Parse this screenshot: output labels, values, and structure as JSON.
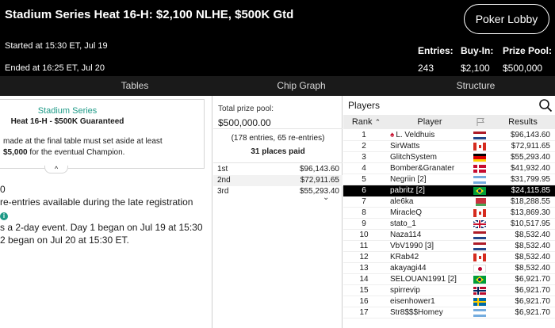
{
  "header": {
    "title": "Stadium Series Heat 16-H: $2,100 NLHE, $500K Gtd",
    "lobby_button": "Poker Lobby",
    "started": "Started at 15:30 ET, Jul 19",
    "ended": "Ended at 16:25 ET, Jul 20",
    "stats": [
      {
        "label": "Entries:",
        "value": "243"
      },
      {
        "label": "Buy-In:",
        "value": "$2,100"
      },
      {
        "label": "Prize Pool:",
        "value": "$500,000"
      }
    ]
  },
  "tabs": [
    "Tables",
    "Chip Graph",
    "Structure"
  ],
  "info": {
    "series": "Stadium Series",
    "event": "Heat 16-H - $500K Guaranteed",
    "desc_line1": "made at the final table must set aside at least",
    "desc_amount": "$5,000",
    "desc_line2_rest": " for the eventual Champion.",
    "caret": "^",
    "note_line1": "0",
    "note_line2": "re-entries available during the late registration",
    "note_icon": "i",
    "note_line4": "s a 2-day event. Day 1 began on Jul 19 at 15:30",
    "note_line5": "2 began on Jul 20 at 15:30 ET."
  },
  "prize": {
    "label": "Total prize pool:",
    "value": "$500,000.00",
    "entries_note": "(178 entries, 65 re-entries)",
    "places_paid": "31 places paid",
    "payouts": [
      {
        "place": "1st",
        "amount": "$96,143.60"
      },
      {
        "place": "2nd",
        "amount": "$72,911.65"
      },
      {
        "place": "3rd",
        "amount": "$55,293.40"
      }
    ],
    "more_caret": "⌄"
  },
  "players": {
    "title": "Players",
    "columns": {
      "rank": "Rank",
      "player": "Player",
      "results": "Results"
    },
    "rows": [
      {
        "rank": "1",
        "name": "L. Veldhuis",
        "flag": "nl",
        "result": "$96,143.60",
        "pro": true
      },
      {
        "rank": "2",
        "name": "SirWatts",
        "flag": "ca",
        "result": "$72,911.65"
      },
      {
        "rank": "3",
        "name": "GlitchSystem",
        "flag": "de",
        "result": "$55,293.40"
      },
      {
        "rank": "4",
        "name": "Bomber&Granater",
        "flag": "dk",
        "result": "$41,932.40"
      },
      {
        "rank": "5",
        "name": "Negriin [2]",
        "flag": "ar",
        "result": "$31,799.95"
      },
      {
        "rank": "6",
        "name": "pabritz [2]",
        "flag": "br",
        "result": "$24,115.85",
        "selected": true
      },
      {
        "rank": "7",
        "name": "ale6ka",
        "flag": "by",
        "result": "$18,288.55"
      },
      {
        "rank": "8",
        "name": "MiracleQ",
        "flag": "ca",
        "result": "$13,869.30"
      },
      {
        "rank": "9",
        "name": "stato_1",
        "flag": "gb",
        "result": "$10,517.95"
      },
      {
        "rank": "10",
        "name": "Naza114",
        "flag": "nl",
        "result": "$8,532.40"
      },
      {
        "rank": "11",
        "name": "VbV1990 [3]",
        "flag": "nl",
        "result": "$8,532.40"
      },
      {
        "rank": "12",
        "name": "KRab42",
        "flag": "ca",
        "result": "$8,532.40"
      },
      {
        "rank": "13",
        "name": "akayagi44",
        "flag": "jp",
        "result": "$8,532.40"
      },
      {
        "rank": "14",
        "name": "SELOUAN1991 [2]",
        "flag": "br",
        "result": "$6,921.70"
      },
      {
        "rank": "15",
        "name": "spirrevip",
        "flag": "no",
        "result": "$6,921.70"
      },
      {
        "rank": "16",
        "name": "eisenhower1",
        "flag": "se",
        "result": "$6,921.70"
      },
      {
        "rank": "17",
        "name": "Str8$$$Homey",
        "flag": "ar",
        "result": "$6,921.70"
      }
    ]
  },
  "colors": {
    "accent": "#1e9a87",
    "header_bg": "#000000",
    "tabs_bg": "#1a1a1a",
    "pro_badge": "#c8102e"
  }
}
